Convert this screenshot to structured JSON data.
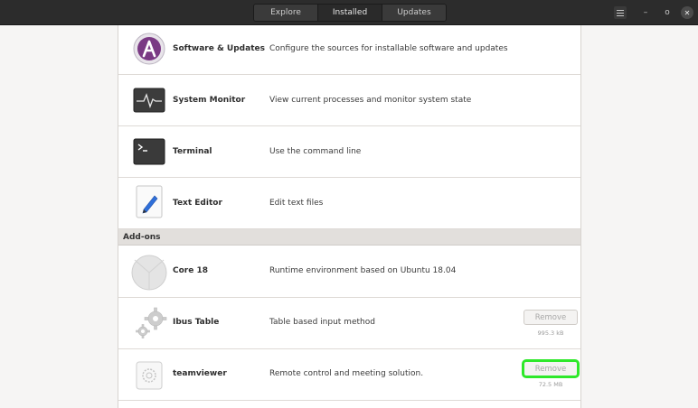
{
  "header": {
    "tabs": [
      {
        "label": "Explore"
      },
      {
        "label": "Installed"
      },
      {
        "label": "Updates"
      }
    ],
    "window_controls": {
      "menu_icon": "hamburger-icon",
      "min_glyph": "–",
      "max_glyph": "o",
      "close_glyph": "✕"
    }
  },
  "apps": [
    {
      "name": "Software & Updates",
      "description": "Configure the sources for installable software and updates",
      "icon": "software-updates-icon"
    },
    {
      "name": "System Monitor",
      "description": "View current processes and monitor system state",
      "icon": "system-monitor-icon"
    },
    {
      "name": "Terminal",
      "description": "Use the command line",
      "icon": "terminal-icon"
    },
    {
      "name": "Text Editor",
      "description": "Edit text files",
      "icon": "text-editor-icon"
    }
  ],
  "addons_section": {
    "label": "Add-ons"
  },
  "addons": [
    {
      "name": "Core 18",
      "description": "Runtime environment based on Ubuntu 18.04",
      "icon": "core-icon"
    },
    {
      "name": "Ibus Table",
      "description": "Table based input method",
      "icon": "gears-icon",
      "button": "Remove",
      "size": "995.3 kB"
    },
    {
      "name": "teamviewer",
      "description": "Remote control and meeting solution.",
      "icon": "teamviewer-icon",
      "button": "Remove",
      "size": "72.5 MB"
    }
  ],
  "colors": {
    "highlight": "#2ee82a",
    "titlebar": "#2c2c2c",
    "accent": "#7a3a84"
  }
}
